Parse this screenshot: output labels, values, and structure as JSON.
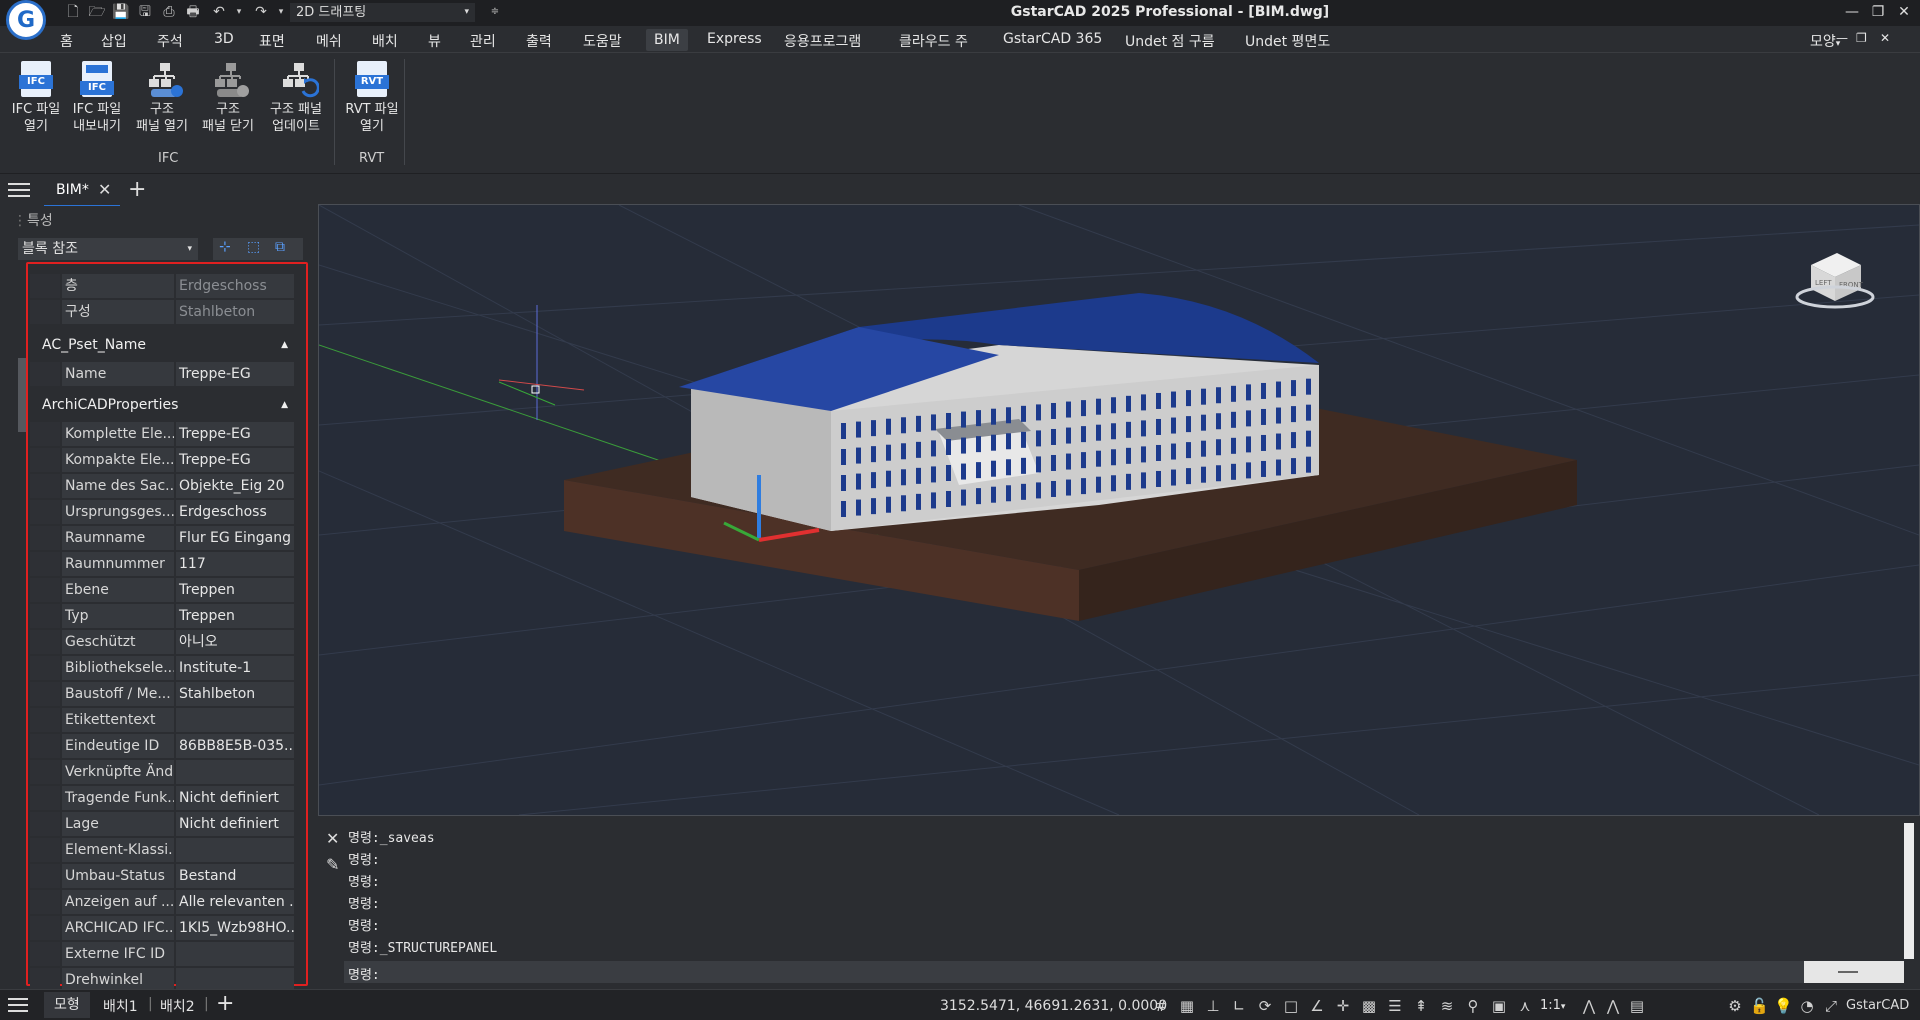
{
  "title_bar": {
    "workspace": "2D 드래프팅",
    "window_title": "GstarCAD 2025 Professional - [BIM.dwg]"
  },
  "menu": [
    "홈",
    "삽입",
    "주석",
    "3D",
    "표면",
    "메쉬",
    "배치",
    "뷰",
    "관리",
    "출력",
    "도움말",
    "BIM",
    "Express",
    "응용프로그램",
    "클라우드 주",
    "GstarCAD 365",
    "Undet 점 구름",
    "Undet 평면도"
  ],
  "menu_active": "BIM",
  "menu_right": "모양",
  "ribbon": {
    "buttons": [
      {
        "line1": "IFC 파일",
        "line2": "열기",
        "icon": "ifc-open-icon",
        "badge": "IFC"
      },
      {
        "line1": "IFC 파일",
        "line2": "내보내기",
        "icon": "ifc-export-icon",
        "badge": "IFC"
      },
      {
        "line1": "구조",
        "line2": "패널 열기",
        "icon": "structure-panel-open-icon"
      },
      {
        "line1": "구조",
        "line2": "패널 닫기",
        "icon": "structure-panel-close-icon"
      },
      {
        "line1": "구조 패널",
        "line2": "업데이트",
        "icon": "structure-panel-update-icon"
      },
      {
        "line1": "RVT 파일",
        "line2": "열기",
        "icon": "rvt-open-icon",
        "badge": "RVT"
      }
    ],
    "groups": [
      "IFC",
      "RVT"
    ]
  },
  "doc_tab": {
    "label": "BIM*"
  },
  "properties": {
    "panel_title": "특성",
    "selector": "블록 참조",
    "top_rows": [
      {
        "label": "층",
        "value": "Erdgeschoss"
      },
      {
        "label": "구성",
        "value": "Stahlbeton"
      }
    ],
    "section1": {
      "title": "AC_Pset_Name",
      "rows": [
        {
          "label": "Name",
          "value": "Treppe-EG"
        }
      ]
    },
    "section2": {
      "title": "ArchiCADProperties",
      "rows": [
        {
          "label": "Komplette Ele...",
          "value": "Treppe-EG"
        },
        {
          "label": "Kompakte Ele...",
          "value": "Treppe-EG"
        },
        {
          "label": "Name des Sac...",
          "value": "Objekte_Eig 20"
        },
        {
          "label": "Ursprungsges...",
          "value": "Erdgeschoss"
        },
        {
          "label": "Raumname",
          "value": "Flur EG Eingang"
        },
        {
          "label": "Raumnummer",
          "value": "117"
        },
        {
          "label": "Ebene",
          "value": "Treppen"
        },
        {
          "label": "Typ",
          "value": "Treppen"
        },
        {
          "label": "Geschützt",
          "value": "아니오"
        },
        {
          "label": "Bibliotheksele...",
          "value": "Institute-1"
        },
        {
          "label": "Baustoff / Me...",
          "value": "Stahlbeton"
        },
        {
          "label": "Etikettentext",
          "value": ""
        },
        {
          "label": "Eindeutige ID",
          "value": "86BB8E5B-035..."
        },
        {
          "label": "Verknüpfte Änd...",
          "value": ""
        },
        {
          "label": "Tragende Funk...",
          "value": "Nicht definiert"
        },
        {
          "label": "Lage",
          "value": "Nicht definiert"
        },
        {
          "label": "Element-Klassi...",
          "value": ""
        },
        {
          "label": "Umbau-Status",
          "value": "Bestand"
        },
        {
          "label": "Anzeigen auf ...",
          "value": "Alle relevanten ..."
        },
        {
          "label": "ARCHICAD IFC...",
          "value": "1KI5_Wzb98HO..."
        },
        {
          "label": "Externe IFC ID",
          "value": ""
        },
        {
          "label": "Drehwinkel",
          "value": ""
        }
      ]
    }
  },
  "viewcube": {
    "left": "LEFT",
    "front": "FRONT"
  },
  "command_lines": [
    "명령:_saveas",
    "명령:",
    "명령:",
    "명령:",
    "명령:",
    "명령:_STRUCTUREPANEL"
  ],
  "command_prompt": "명령:",
  "status": {
    "tabs": [
      "모형",
      "배치1",
      "배치2"
    ],
    "coords": "3152.5471, 46691.2631, 0.0000",
    "scale": "1:1",
    "brand": "GstarCAD"
  },
  "colors": {
    "highlight": "#e02020",
    "roof": "#1c3a8c",
    "ground": "#3a2a22",
    "accent": "#2b73d6"
  }
}
